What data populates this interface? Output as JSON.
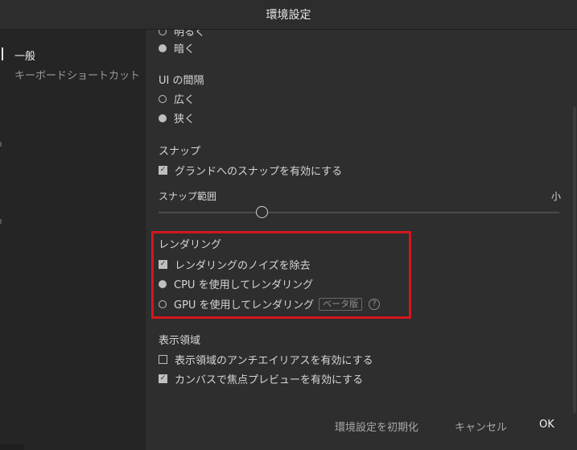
{
  "window": {
    "title": "環境設定"
  },
  "sidebar": {
    "items": [
      {
        "label": "一般",
        "active": true
      },
      {
        "label": "キーボードショートカット",
        "active": false
      }
    ]
  },
  "theme_partial": {
    "cut_label": "明るく",
    "dark_label": "暗く"
  },
  "ui_spacing": {
    "heading": "UI の間隔",
    "wide": "広く",
    "narrow": "狭く"
  },
  "snap": {
    "heading": "スナップ",
    "enable_grid_snap": "グランドへのスナップを有効にする",
    "range_label": "スナップ範囲",
    "range_max": "小",
    "range_value_fraction": 0.27
  },
  "rendering": {
    "heading": "レンダリング",
    "noise_reduction": "レンダリングのノイズを除去",
    "use_cpu": "CPU を使用してレンダリング",
    "use_gpu": "GPU を使用してレンダリング",
    "beta_badge": "ベータ版",
    "help_glyph": "?"
  },
  "display_area": {
    "heading": "表示領域",
    "antialias": "表示領域のアンチエイリアスを有効にする",
    "focus_preview": "カンバスで焦点プレビューを有効にする"
  },
  "footer": {
    "reset": "環境設定を初期化",
    "cancel": "キャンセル",
    "ok": "OK"
  },
  "colors": {
    "highlight": "#d4161c",
    "background": "#2e2e2e",
    "sidebar": "#252525"
  },
  "icons": {
    "checkbox_checked": "check-icon",
    "help": "question-circle-icon"
  }
}
